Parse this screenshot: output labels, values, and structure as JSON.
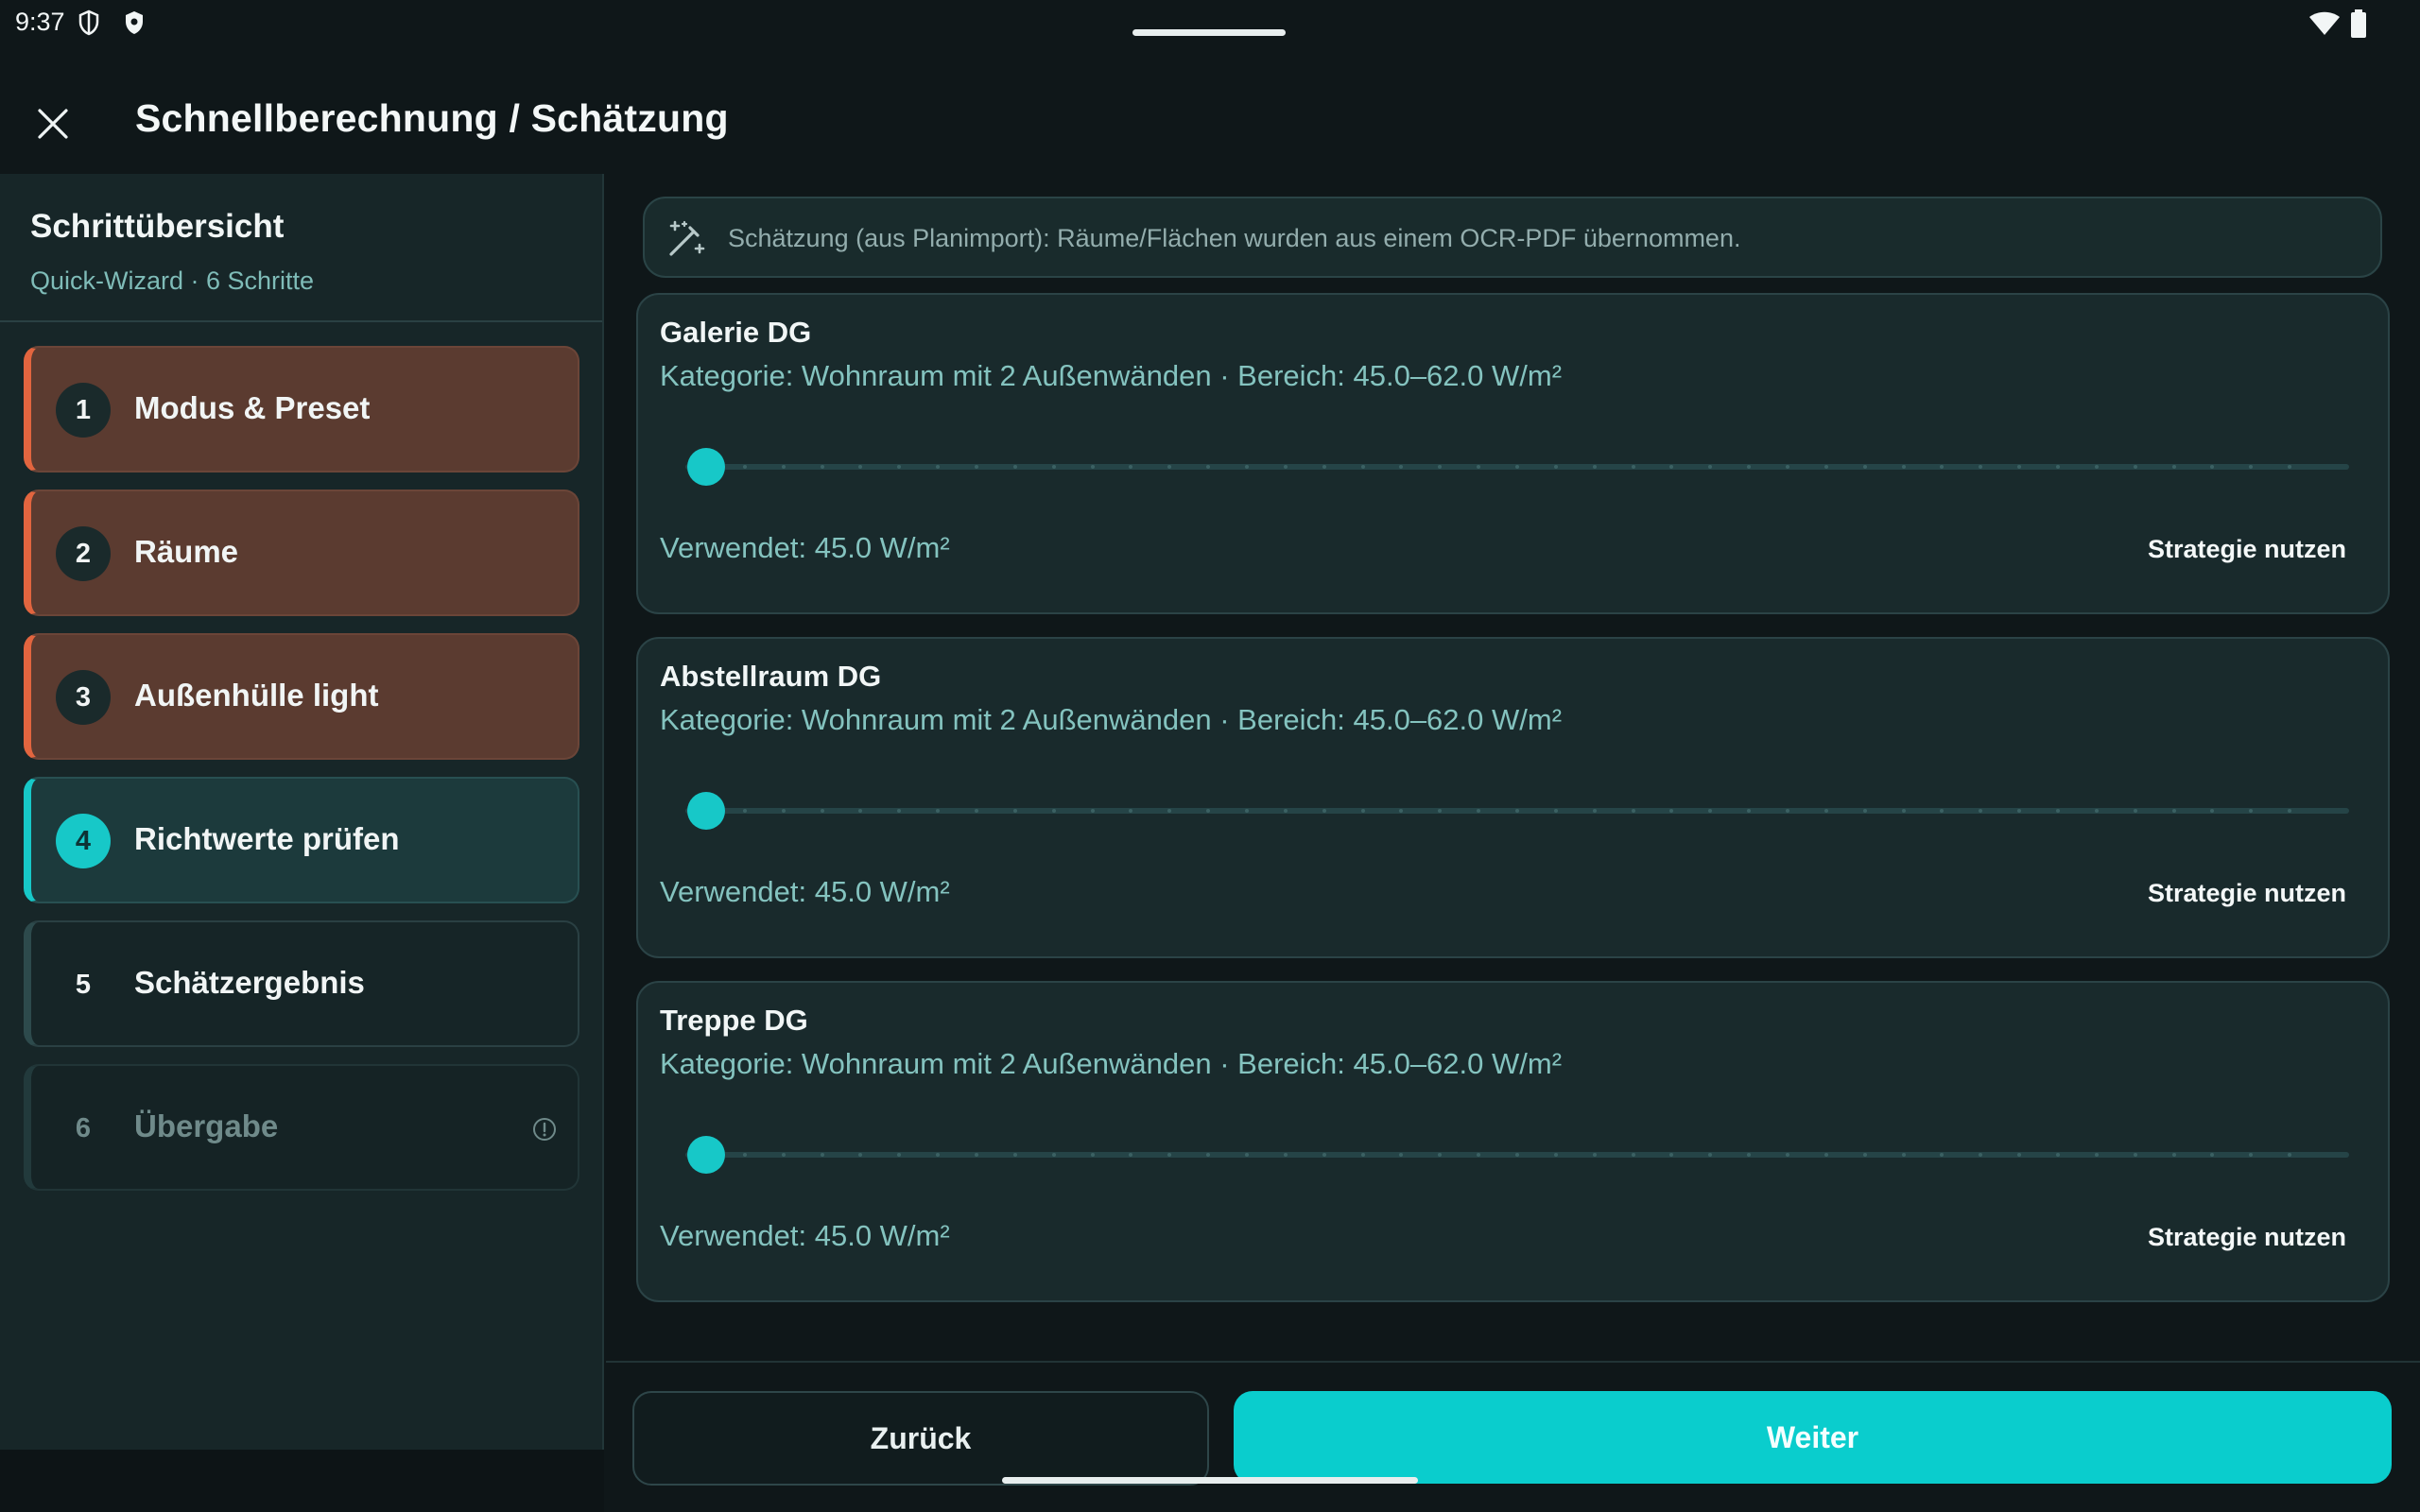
{
  "status_bar": {
    "time": "9:37",
    "icons": [
      "privacy-shield-icon",
      "security-shield-icon",
      "wifi-icon",
      "battery-icon"
    ]
  },
  "app_bar": {
    "title": "Schnellberechnung / Schätzung",
    "close_icon": "close-icon"
  },
  "sidebar": {
    "title": "Schrittübersicht",
    "subtitle": "Quick-Wizard · 6 Schritte",
    "steps": [
      {
        "number": "1",
        "label": "Modus & Preset",
        "state": "done"
      },
      {
        "number": "2",
        "label": "Räume",
        "state": "done"
      },
      {
        "number": "3",
        "label": "Außenhülle light",
        "state": "done"
      },
      {
        "number": "4",
        "label": "Richtwerte prüfen",
        "state": "active"
      },
      {
        "number": "5",
        "label": "Schätzergebnis",
        "state": "todo"
      },
      {
        "number": "6",
        "label": "Übergabe",
        "state": "locked"
      }
    ]
  },
  "banner": {
    "icon": "magic-wand-icon",
    "text": "Schätzung (aus Planimport): Räume/Flächen wurden aus einem OCR-PDF übernommen."
  },
  "rooms": [
    {
      "name": "Galerie DG",
      "category": "Kategorie: Wohnraum mit 2 Außenwänden · Bereich: 45.0–62.0 W/m²",
      "used": "Verwendet: 45.0 W/m²",
      "action": "Strategie nutzen",
      "slider_min": 45.0,
      "slider_max": 62.0,
      "slider_value": 45.0
    },
    {
      "name": "Abstellraum DG",
      "category": "Kategorie: Wohnraum mit 2 Außenwänden · Bereich: 45.0–62.0 W/m²",
      "used": "Verwendet: 45.0 W/m²",
      "action": "Strategie nutzen",
      "slider_min": 45.0,
      "slider_max": 62.0,
      "slider_value": 45.0
    },
    {
      "name": "Treppe DG",
      "category": "Kategorie: Wohnraum mit 2 Außenwänden · Bereich: 45.0–62.0 W/m²",
      "used": "Verwendet: 45.0 W/m²",
      "action": "Strategie nutzen",
      "slider_min": 45.0,
      "slider_max": 62.0,
      "slider_value": 45.0
    }
  ],
  "footer": {
    "back_label": "Zurück",
    "next_label": "Weiter"
  },
  "colors": {
    "accent": "#0acdcd",
    "done_step": "#5b3b30",
    "done_marker": "#e2653f",
    "background": "#0f1719"
  }
}
